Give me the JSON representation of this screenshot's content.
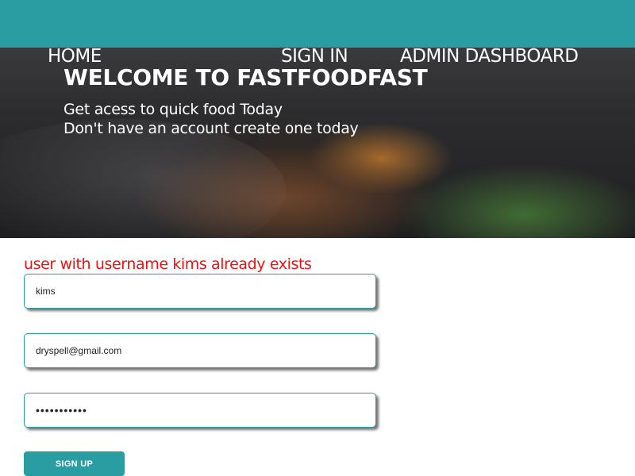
{
  "nav": {
    "home_label": "HOME",
    "signin_label": "SIGN IN",
    "admin_label": "ADMIN DASHBOARD"
  },
  "hero": {
    "title": "WELCOME TO FASTFOODFAST",
    "line1": "Get acess to quick food Today",
    "line2": "Don't have an account create one today"
  },
  "form": {
    "error_message": "user with username kims already exists",
    "username_value": "kims",
    "email_value": "dryspell@gmail.com",
    "password_value": "password123",
    "submit_label": "SIGN UP"
  },
  "colors": {
    "accent": "#2a9da3",
    "error": "#ee1111"
  }
}
